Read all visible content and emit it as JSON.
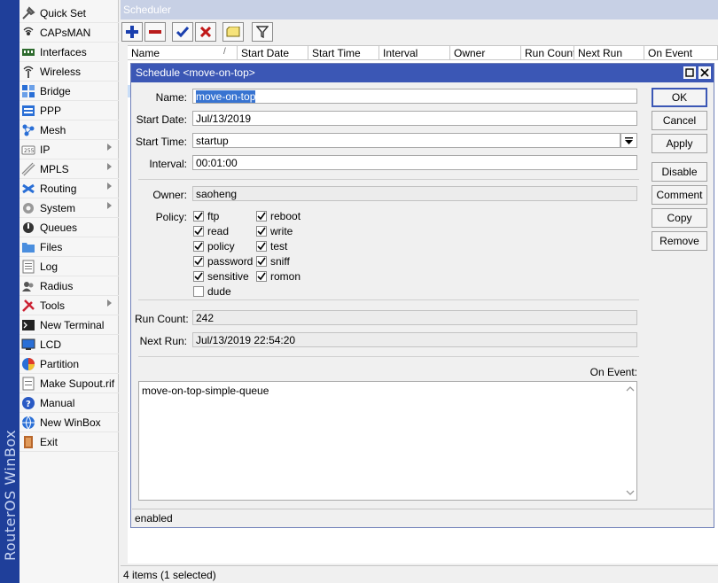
{
  "brand": "RouterOS WinBox",
  "sidebar": {
    "items": [
      {
        "label": "Quick Set",
        "icon": "quick-set-icon",
        "submenu": false
      },
      {
        "label": "CAPsMAN",
        "icon": "capsman-icon",
        "submenu": false
      },
      {
        "label": "Interfaces",
        "icon": "interfaces-icon",
        "submenu": false
      },
      {
        "label": "Wireless",
        "icon": "wireless-icon",
        "submenu": false
      },
      {
        "label": "Bridge",
        "icon": "bridge-icon",
        "submenu": false
      },
      {
        "label": "PPP",
        "icon": "ppp-icon",
        "submenu": false
      },
      {
        "label": "Mesh",
        "icon": "mesh-icon",
        "submenu": false
      },
      {
        "label": "IP",
        "icon": "ip-icon",
        "submenu": true
      },
      {
        "label": "MPLS",
        "icon": "mpls-icon",
        "submenu": true
      },
      {
        "label": "Routing",
        "icon": "routing-icon",
        "submenu": true
      },
      {
        "label": "System",
        "icon": "system-icon",
        "submenu": true
      },
      {
        "label": "Queues",
        "icon": "queues-icon",
        "submenu": false
      },
      {
        "label": "Files",
        "icon": "files-icon",
        "submenu": false
      },
      {
        "label": "Log",
        "icon": "log-icon",
        "submenu": false
      },
      {
        "label": "Radius",
        "icon": "radius-icon",
        "submenu": false
      },
      {
        "label": "Tools",
        "icon": "tools-icon",
        "submenu": true
      },
      {
        "label": "New Terminal",
        "icon": "terminal-icon",
        "submenu": false
      },
      {
        "label": "LCD",
        "icon": "lcd-icon",
        "submenu": false
      },
      {
        "label": "Partition",
        "icon": "partition-icon",
        "submenu": false
      },
      {
        "label": "Make Supout.rif",
        "icon": "supout-icon",
        "submenu": false
      },
      {
        "label": "Manual",
        "icon": "manual-icon",
        "submenu": false
      },
      {
        "label": "New WinBox",
        "icon": "winbox-icon",
        "submenu": false
      },
      {
        "label": "Exit",
        "icon": "exit-icon",
        "submenu": false
      }
    ]
  },
  "scheduler": {
    "title": "Scheduler",
    "columns": [
      "Name",
      "Start Date",
      "Start Time",
      "Interval",
      "Owner",
      "Run Count",
      "Next Run",
      "On Event"
    ],
    "status": "4 items (1 selected)"
  },
  "dialog": {
    "title": "Schedule <move-on-top>",
    "labels": {
      "name": "Name:",
      "start_date": "Start Date:",
      "start_time": "Start Time:",
      "interval": "Interval:",
      "owner": "Owner:",
      "policy": "Policy:",
      "run_count": "Run Count:",
      "next_run": "Next Run:",
      "on_event": "On Event:"
    },
    "values": {
      "name": "move-on-top",
      "start_date": "Jul/13/2019",
      "start_time": "startup",
      "interval": "00:01:00",
      "owner": "saoheng",
      "run_count": "242",
      "next_run": "Jul/13/2019 22:54:20",
      "on_event": "move-on-top-simple-queue"
    },
    "policies_left": [
      {
        "label": "ftp",
        "checked": true
      },
      {
        "label": "read",
        "checked": true
      },
      {
        "label": "policy",
        "checked": true
      },
      {
        "label": "password",
        "checked": true
      },
      {
        "label": "sensitive",
        "checked": true
      },
      {
        "label": "dude",
        "checked": false
      }
    ],
    "policies_right": [
      {
        "label": "reboot",
        "checked": true
      },
      {
        "label": "write",
        "checked": true
      },
      {
        "label": "test",
        "checked": true
      },
      {
        "label": "sniff",
        "checked": true
      },
      {
        "label": "romon",
        "checked": true
      }
    ],
    "buttons": {
      "ok": "OK",
      "cancel": "Cancel",
      "apply": "Apply",
      "disable": "Disable",
      "comment": "Comment",
      "copy": "Copy",
      "remove": "Remove"
    },
    "status": "enabled"
  },
  "colors": {
    "brand_strip": "#1f3f9a",
    "dialog_title": "#3b57b5",
    "selection": "#3874d1"
  }
}
